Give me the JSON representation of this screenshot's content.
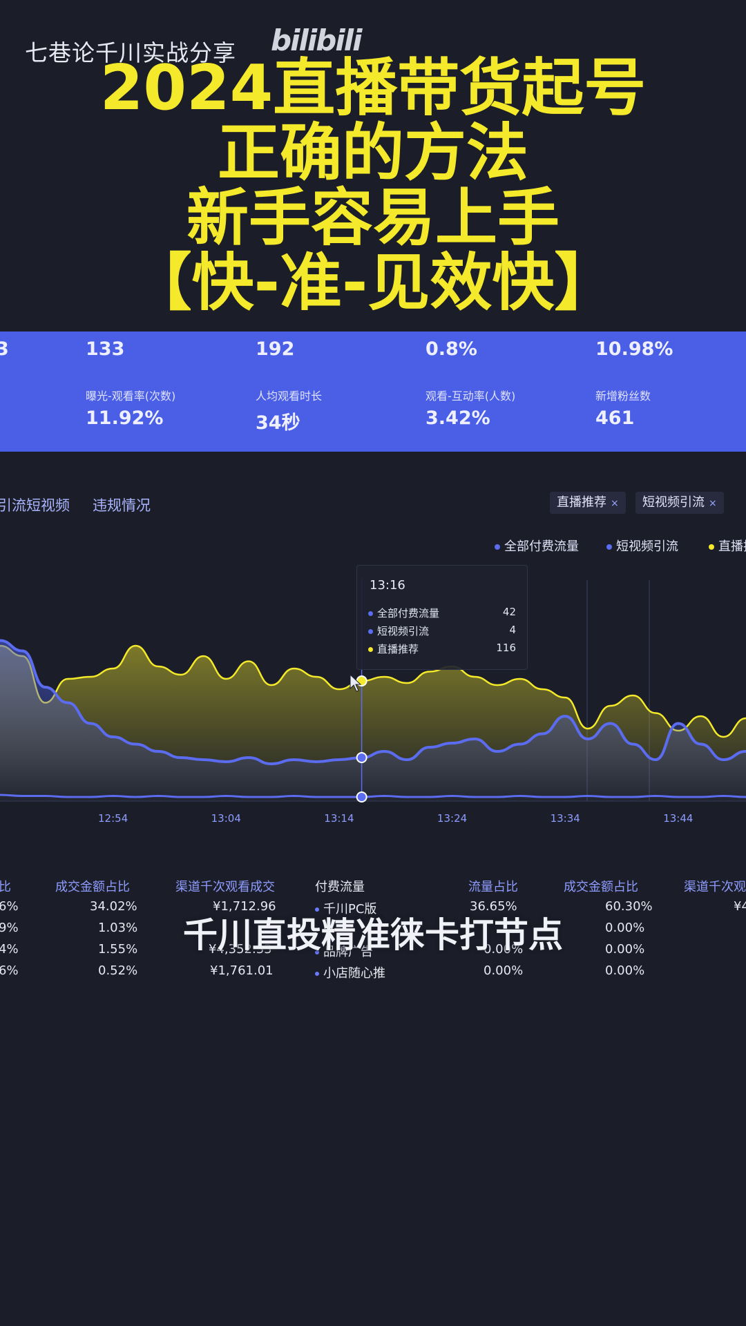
{
  "header": {
    "watermark": "七巷论千川实战分享",
    "logo_text": "bilibili",
    "title_lines": [
      "2024直播带货起号",
      "正确的方法",
      "新手容易上手",
      "【快-准-见效快】"
    ]
  },
  "stats": {
    "row1": [
      "3",
      "133",
      "192",
      "0.8%",
      "10.98%"
    ],
    "labels": [
      "曝光-观看率(次数)",
      "人均观看时长",
      "观看-互动率(人数)",
      "新增粉丝数"
    ],
    "row2": [
      "11.92%",
      "34秒",
      "3.42%",
      "461"
    ]
  },
  "tabs": [
    "引流短视频",
    "违规情况"
  ],
  "filters": [
    {
      "label": "直播推荐",
      "close": "×"
    },
    {
      "label": "短视频引流",
      "close": "×"
    }
  ],
  "legend": [
    {
      "label": "全部付费流量",
      "color": "#5b6cf0"
    },
    {
      "label": "短视频引流",
      "color": "#5b6cf0"
    },
    {
      "label": "直播推荐",
      "color": "#f4e92a"
    }
  ],
  "tooltip": {
    "time": "13:16",
    "rows": [
      {
        "label": "全部付费流量",
        "value": "42",
        "color": "#5b6cf0"
      },
      {
        "label": "短视频引流",
        "value": "4",
        "color": "#5b6cf0"
      },
      {
        "label": "直播推荐",
        "value": "116",
        "color": "#f4e92a"
      }
    ]
  },
  "chart_data": {
    "type": "area",
    "x": [
      "12:44",
      "12:46",
      "12:48",
      "12:50",
      "12:52",
      "12:54",
      "12:56",
      "12:58",
      "13:00",
      "13:02",
      "13:04",
      "13:06",
      "13:08",
      "13:10",
      "13:12",
      "13:14",
      "13:16",
      "13:18",
      "13:20",
      "13:22",
      "13:24",
      "13:26",
      "13:28",
      "13:30",
      "13:32",
      "13:34",
      "13:36",
      "13:38",
      "13:40",
      "13:42",
      "13:44",
      "13:46",
      "13:48",
      "13:50"
    ],
    "xticks": [
      "12:54",
      "13:04",
      "13:14",
      "13:24",
      "13:34",
      "13:44"
    ],
    "series": [
      {
        "name": "直播推荐",
        "color": "#f4e92a",
        "values": [
          150,
          140,
          95,
          118,
          120,
          128,
          150,
          130,
          122,
          140,
          118,
          135,
          112,
          128,
          120,
          108,
          116,
          120,
          114,
          125,
          130,
          120,
          112,
          118,
          108,
          100,
          70,
          92,
          102,
          85,
          68,
          82,
          62,
          80
        ]
      },
      {
        "name": "全部付费流量",
        "color": "#5b6cf0",
        "values": [
          155,
          145,
          110,
          95,
          75,
          62,
          55,
          48,
          42,
          40,
          38,
          42,
          36,
          40,
          38,
          40,
          42,
          48,
          40,
          52,
          56,
          60,
          48,
          55,
          65,
          82,
          60,
          75,
          55,
          40,
          75,
          55,
          40,
          48
        ]
      },
      {
        "name": "短视频引流",
        "color": "#5b6cf0",
        "values": [
          6,
          5,
          5,
          4,
          4,
          5,
          4,
          5,
          4,
          4,
          5,
          4,
          4,
          5,
          4,
          4,
          4,
          5,
          4,
          4,
          5,
          4,
          4,
          5,
          4,
          4,
          5,
          4,
          4,
          5,
          4,
          4,
          5,
          4
        ]
      }
    ],
    "ylim": [
      0,
      220
    ],
    "highlight_x": "13:16"
  },
  "table": {
    "left_headers": [
      "比",
      "成交金额占比",
      "渠道千次观看成交"
    ],
    "right_headers": [
      "付费流量",
      "流量占比",
      "成交金额占比",
      "渠道千次观"
    ],
    "left_rows": [
      [
        "6%",
        "34.02%",
        ""
      ],
      [
        "9%",
        "1.03%",
        ""
      ],
      [
        "4%",
        "1.55%",
        "¥4,352.33"
      ],
      [
        "6%",
        "0.52%",
        "¥1,761.01"
      ]
    ],
    "first_value": "¥1,712.96",
    "right_rows": [
      [
        "千川PC版",
        "36.65%",
        "60.30%",
        "¥4"
      ],
      [
        "",
        "",
        "0.00%",
        ""
      ],
      [
        "品牌广告",
        "0.00%",
        "0.00%",
        ""
      ],
      [
        "小店随心推",
        "0.00%",
        "0.00%",
        ""
      ]
    ]
  },
  "subtitle": "千川直投精准徕卡打节点"
}
